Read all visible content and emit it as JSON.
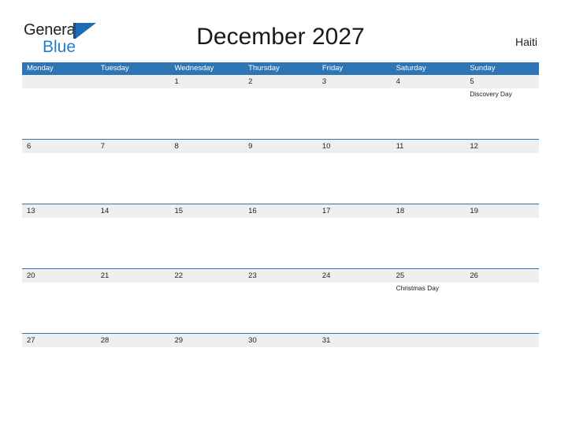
{
  "brand": {
    "line1": "General",
    "line2": "Blue",
    "flag_icon": "triangle-flag-icon",
    "colors": {
      "text_dark": "#231f20",
      "blue": "#1b7fd4",
      "flag_blue": "#1b6cb5"
    }
  },
  "header": {
    "title": "December 2027",
    "country": "Haiti"
  },
  "calendar": {
    "header_bg": "#2e75b6",
    "date_band_bg": "#efefef",
    "weekdays": [
      "Monday",
      "Tuesday",
      "Wednesday",
      "Thursday",
      "Friday",
      "Saturday",
      "Sunday"
    ],
    "weeks": [
      {
        "days": [
          {
            "date": "",
            "events": []
          },
          {
            "date": "",
            "events": []
          },
          {
            "date": "1",
            "events": []
          },
          {
            "date": "2",
            "events": []
          },
          {
            "date": "3",
            "events": []
          },
          {
            "date": "4",
            "events": []
          },
          {
            "date": "5",
            "events": [
              "Discovery Day"
            ]
          }
        ]
      },
      {
        "days": [
          {
            "date": "6",
            "events": []
          },
          {
            "date": "7",
            "events": []
          },
          {
            "date": "8",
            "events": []
          },
          {
            "date": "9",
            "events": []
          },
          {
            "date": "10",
            "events": []
          },
          {
            "date": "11",
            "events": []
          },
          {
            "date": "12",
            "events": []
          }
        ]
      },
      {
        "days": [
          {
            "date": "13",
            "events": []
          },
          {
            "date": "14",
            "events": []
          },
          {
            "date": "15",
            "events": []
          },
          {
            "date": "16",
            "events": []
          },
          {
            "date": "17",
            "events": []
          },
          {
            "date": "18",
            "events": []
          },
          {
            "date": "19",
            "events": []
          }
        ]
      },
      {
        "days": [
          {
            "date": "20",
            "events": []
          },
          {
            "date": "21",
            "events": []
          },
          {
            "date": "22",
            "events": []
          },
          {
            "date": "23",
            "events": []
          },
          {
            "date": "24",
            "events": []
          },
          {
            "date": "25",
            "events": [
              "Christmas Day"
            ]
          },
          {
            "date": "26",
            "events": []
          }
        ]
      },
      {
        "days": [
          {
            "date": "27",
            "events": []
          },
          {
            "date": "28",
            "events": []
          },
          {
            "date": "29",
            "events": []
          },
          {
            "date": "30",
            "events": []
          },
          {
            "date": "31",
            "events": []
          },
          {
            "date": "",
            "events": []
          },
          {
            "date": "",
            "events": []
          }
        ]
      }
    ]
  }
}
